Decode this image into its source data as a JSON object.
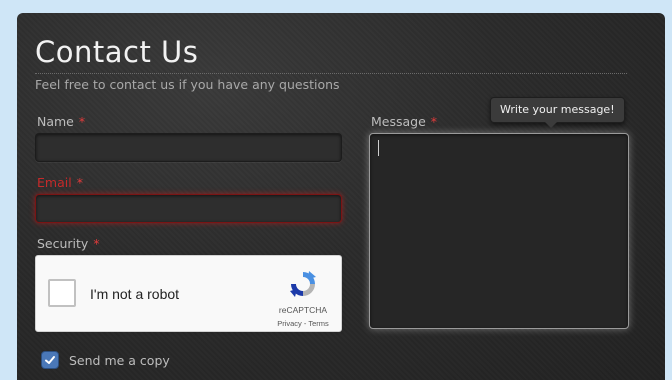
{
  "form": {
    "title": "Contact Us",
    "subtitle": "Feel free to contact us if you have any questions",
    "required_marker": "*",
    "name_label": "Name",
    "name_value": "",
    "email_label": "Email",
    "email_value": "",
    "email_state": "error",
    "security_label": "Security",
    "message_label": "Message",
    "message_value": "",
    "message_tooltip": "Write your message!",
    "copy_label": "Send me a copy",
    "copy_checked": true
  },
  "captcha": {
    "checkbox_label": "I'm not a robot",
    "brand": "reCAPTCHA",
    "links": "Privacy - Terms"
  },
  "colors": {
    "panel_background": "#2b2b2b",
    "page_background": "#cfe6f7",
    "required_marker": "#e23b3b",
    "error": "#c62a2a",
    "checkbox_checked": "#4a78b8"
  }
}
